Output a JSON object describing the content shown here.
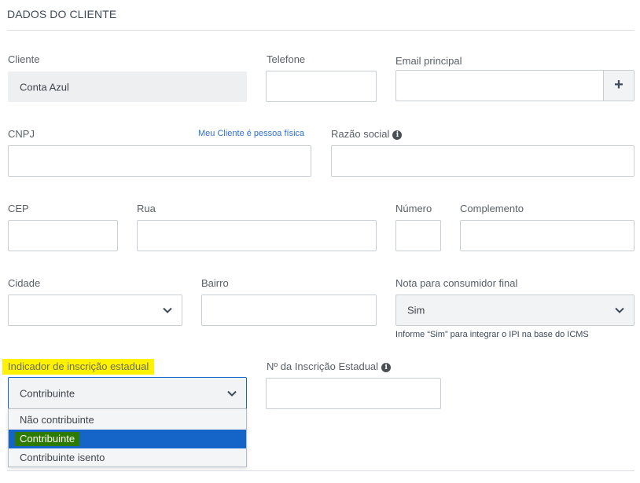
{
  "section": {
    "title": "DADOS DO CLIENTE"
  },
  "cliente": {
    "label": "Cliente",
    "value": "Conta Azul"
  },
  "telefone": {
    "label": "Telefone",
    "value": ""
  },
  "email": {
    "label": "Email principal",
    "value": "",
    "add_symbol": "+"
  },
  "cnpj": {
    "label": "CNPJ",
    "value": "",
    "link": "Meu Cliente é pessoa física"
  },
  "razao_social": {
    "label": "Razão social",
    "value": "",
    "info_symbol": "i"
  },
  "cep": {
    "label": "CEP",
    "value": ""
  },
  "rua": {
    "label": "Rua",
    "value": ""
  },
  "numero": {
    "label": "Número",
    "value": ""
  },
  "complemento": {
    "label": "Complemento",
    "value": ""
  },
  "cidade": {
    "label": "Cidade",
    "value": ""
  },
  "bairro": {
    "label": "Bairro",
    "value": ""
  },
  "consumidor_final": {
    "label": "Nota para consumidor final",
    "value": "Sim",
    "hint": "Informe “Sim” para integrar o IPI na base do ICMS"
  },
  "indicador_ie": {
    "label": "Indicador de inscrição estadual",
    "value": "Contribuinte",
    "options": [
      "Não contribuinte",
      "Contribuinte",
      "Contribuinte isento"
    ],
    "selected_index": 1
  },
  "inscricao_estadual": {
    "label": "Nº da Inscrição Estadual",
    "value": "",
    "info_symbol": "i"
  },
  "colors": {
    "accent": "#1565c8",
    "highlight": "#fff200",
    "link": "#2f6fd0"
  }
}
